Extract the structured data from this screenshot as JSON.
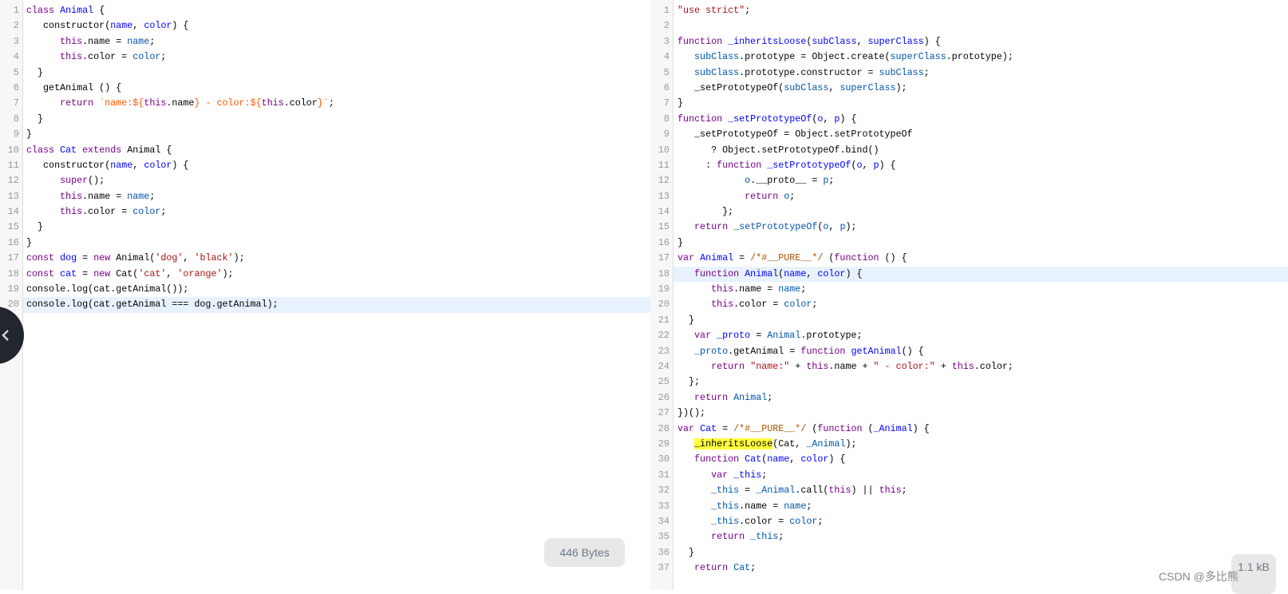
{
  "colors": {
    "keyword": "#770088",
    "def": "#0000ff",
    "variable": "#0055aa",
    "string": "#aa1111",
    "template": "#ff5500",
    "comment": "#aa5500",
    "highlight": "#ffff3c",
    "active_line": "#e8f2ff"
  },
  "left": {
    "active_line": 20,
    "size_label": "446 Bytes",
    "lines": [
      [
        [
          "class",
          "k"
        ],
        [
          " "
        ],
        [
          "Animal",
          "d"
        ],
        [
          " {"
        ]
      ],
      [
        [
          "   constructor("
        ],
        [
          "name",
          "d"
        ],
        [
          ", "
        ],
        [
          "color",
          "d"
        ],
        [
          ") {"
        ]
      ],
      [
        [
          "      "
        ],
        [
          "this",
          "k"
        ],
        [
          ".name = "
        ],
        [
          "name",
          "v"
        ],
        [
          ";"
        ]
      ],
      [
        [
          "      "
        ],
        [
          "this",
          "k"
        ],
        [
          ".color = "
        ],
        [
          "color",
          "v"
        ],
        [
          ";"
        ]
      ],
      [
        [
          "  }"
        ]
      ],
      [
        [
          "   getAnimal () {"
        ]
      ],
      [
        [
          "      "
        ],
        [
          "return",
          "k"
        ],
        [
          " "
        ],
        [
          "`name:${",
          "t"
        ],
        [
          "this",
          "k"
        ],
        [
          ".name"
        ],
        [
          "} - color:${",
          "t"
        ],
        [
          "this",
          "k"
        ],
        [
          ".color"
        ],
        [
          "}`",
          "t"
        ],
        [
          ";"
        ]
      ],
      [
        [
          "  }"
        ]
      ],
      [
        [
          "}"
        ]
      ],
      [
        [
          "class",
          "k"
        ],
        [
          " "
        ],
        [
          "Cat",
          "d"
        ],
        [
          " "
        ],
        [
          "extends",
          "k"
        ],
        [
          " Animal {"
        ]
      ],
      [
        [
          "   constructor("
        ],
        [
          "name",
          "d"
        ],
        [
          ", "
        ],
        [
          "color",
          "d"
        ],
        [
          ") {"
        ]
      ],
      [
        [
          "      "
        ],
        [
          "super",
          "k"
        ],
        [
          "();"
        ]
      ],
      [
        [
          "      "
        ],
        [
          "this",
          "k"
        ],
        [
          ".name = "
        ],
        [
          "name",
          "v"
        ],
        [
          ";"
        ]
      ],
      [
        [
          "      "
        ],
        [
          "this",
          "k"
        ],
        [
          ".color = "
        ],
        [
          "color",
          "v"
        ],
        [
          ";"
        ]
      ],
      [
        [
          "  }"
        ]
      ],
      [
        [
          "}"
        ]
      ],
      [
        [
          "const",
          "k"
        ],
        [
          " "
        ],
        [
          "dog",
          "d"
        ],
        [
          " = "
        ],
        [
          "new",
          "k"
        ],
        [
          " Animal("
        ],
        [
          "'dog'",
          "s"
        ],
        [
          ", "
        ],
        [
          "'black'",
          "s"
        ],
        [
          ");"
        ]
      ],
      [
        [
          "const",
          "k"
        ],
        [
          " "
        ],
        [
          "cat",
          "d"
        ],
        [
          " = "
        ],
        [
          "new",
          "k"
        ],
        [
          " Cat("
        ],
        [
          "'cat'",
          "s"
        ],
        [
          ", "
        ],
        [
          "'orange'",
          "s"
        ],
        [
          ");"
        ]
      ],
      [
        [
          "console.log(cat.getAnimal());"
        ]
      ],
      [
        [
          "console.log(cat.getAnimal === dog.getAnimal);"
        ]
      ]
    ]
  },
  "right": {
    "active_line": 18,
    "size_label": "1.1 kB",
    "lines": [
      [
        [
          "\"use strict\"",
          "s"
        ],
        [
          ";"
        ]
      ],
      [
        [
          ""
        ]
      ],
      [
        [
          "function",
          "k"
        ],
        [
          " "
        ],
        [
          "_inheritsLoose",
          "d"
        ],
        [
          "("
        ],
        [
          "subClass",
          "d"
        ],
        [
          ", "
        ],
        [
          "superClass",
          "d"
        ],
        [
          ") {"
        ]
      ],
      [
        [
          "   "
        ],
        [
          "subClass",
          "v"
        ],
        [
          ".prototype = Object.create("
        ],
        [
          "superClass",
          "v"
        ],
        [
          ".prototype);"
        ]
      ],
      [
        [
          "   "
        ],
        [
          "subClass",
          "v"
        ],
        [
          ".prototype.constructor = "
        ],
        [
          "subClass",
          "v"
        ],
        [
          ";"
        ]
      ],
      [
        [
          "   _setPrototypeOf("
        ],
        [
          "subClass",
          "v"
        ],
        [
          ", "
        ],
        [
          "superClass",
          "v"
        ],
        [
          ");"
        ]
      ],
      [
        [
          "}"
        ]
      ],
      [
        [
          "function",
          "k"
        ],
        [
          " "
        ],
        [
          "_setPrototypeOf",
          "d"
        ],
        [
          "("
        ],
        [
          "o",
          "d"
        ],
        [
          ", "
        ],
        [
          "p",
          "d"
        ],
        [
          ") {"
        ]
      ],
      [
        [
          "   _setPrototypeOf = Object.setPrototypeOf"
        ]
      ],
      [
        [
          "      ? Object.setPrototypeOf.bind()"
        ]
      ],
      [
        [
          "     : "
        ],
        [
          "function",
          "k"
        ],
        [
          " "
        ],
        [
          "_setPrototypeOf",
          "d"
        ],
        [
          "("
        ],
        [
          "o",
          "d"
        ],
        [
          ", "
        ],
        [
          "p",
          "d"
        ],
        [
          ") {"
        ]
      ],
      [
        [
          "            "
        ],
        [
          "o",
          "v"
        ],
        [
          ".__proto__ = "
        ],
        [
          "p",
          "v"
        ],
        [
          ";"
        ]
      ],
      [
        [
          "            "
        ],
        [
          "return",
          "k"
        ],
        [
          " "
        ],
        [
          "o",
          "v"
        ],
        [
          ";"
        ]
      ],
      [
        [
          "        };"
        ]
      ],
      [
        [
          "   "
        ],
        [
          "return",
          "k"
        ],
        [
          " "
        ],
        [
          "_setPrototypeOf",
          "v"
        ],
        [
          "("
        ],
        [
          "o",
          "v"
        ],
        [
          ", "
        ],
        [
          "p",
          "v"
        ],
        [
          ");"
        ]
      ],
      [
        [
          "}"
        ]
      ],
      [
        [
          "var",
          "k"
        ],
        [
          " "
        ],
        [
          "Animal",
          "d"
        ],
        [
          " = "
        ],
        [
          "/*#__PURE__*/",
          "c"
        ],
        [
          " ("
        ],
        [
          "function",
          "k"
        ],
        [
          " () {"
        ]
      ],
      [
        [
          "   "
        ],
        [
          "function",
          "k"
        ],
        [
          " "
        ],
        [
          "Animal",
          "d"
        ],
        [
          "("
        ],
        [
          "name",
          "d"
        ],
        [
          ", "
        ],
        [
          "color",
          "d"
        ],
        [
          ") {"
        ]
      ],
      [
        [
          "      "
        ],
        [
          "this",
          "k"
        ],
        [
          ".name = "
        ],
        [
          "name",
          "v"
        ],
        [
          ";"
        ]
      ],
      [
        [
          "      "
        ],
        [
          "this",
          "k"
        ],
        [
          ".color = "
        ],
        [
          "color",
          "v"
        ],
        [
          ";"
        ]
      ],
      [
        [
          "  }"
        ]
      ],
      [
        [
          "   "
        ],
        [
          "var",
          "k"
        ],
        [
          " "
        ],
        [
          "_proto",
          "d"
        ],
        [
          " = "
        ],
        [
          "Animal",
          "v"
        ],
        [
          ".prototype;"
        ]
      ],
      [
        [
          "   "
        ],
        [
          "_proto",
          "v"
        ],
        [
          ".getAnimal = "
        ],
        [
          "function",
          "k"
        ],
        [
          " "
        ],
        [
          "getAnimal",
          "d"
        ],
        [
          "() {"
        ]
      ],
      [
        [
          "      "
        ],
        [
          "return",
          "k"
        ],
        [
          " "
        ],
        [
          "\"name:\"",
          "s"
        ],
        [
          " + "
        ],
        [
          "this",
          "k"
        ],
        [
          ".name + "
        ],
        [
          "\" - color:\"",
          "s"
        ],
        [
          " + "
        ],
        [
          "this",
          "k"
        ],
        [
          ".color;"
        ]
      ],
      [
        [
          "  };"
        ]
      ],
      [
        [
          "   "
        ],
        [
          "return",
          "k"
        ],
        [
          " "
        ],
        [
          "Animal",
          "v"
        ],
        [
          ";"
        ]
      ],
      [
        [
          "})();"
        ]
      ],
      [
        [
          "var",
          "k"
        ],
        [
          " "
        ],
        [
          "Cat",
          "d"
        ],
        [
          " = "
        ],
        [
          "/*#__PURE__*/",
          "c"
        ],
        [
          " ("
        ],
        [
          "function",
          "k"
        ],
        [
          " ("
        ],
        [
          "_Animal",
          "d"
        ],
        [
          ") {"
        ]
      ],
      [
        [
          "   "
        ],
        [
          "_inheritsLoose",
          "h"
        ],
        [
          "(Cat, "
        ],
        [
          "_Animal",
          "v"
        ],
        [
          ");"
        ]
      ],
      [
        [
          "   "
        ],
        [
          "function",
          "k"
        ],
        [
          " "
        ],
        [
          "Cat",
          "d"
        ],
        [
          "("
        ],
        [
          "name",
          "d"
        ],
        [
          ", "
        ],
        [
          "color",
          "d"
        ],
        [
          ") {"
        ]
      ],
      [
        [
          "      "
        ],
        [
          "var",
          "k"
        ],
        [
          " "
        ],
        [
          "_this",
          "d"
        ],
        [
          ";"
        ]
      ],
      [
        [
          "      "
        ],
        [
          "_this",
          "v"
        ],
        [
          " = "
        ],
        [
          "_Animal",
          "v"
        ],
        [
          ".call("
        ],
        [
          "this",
          "k"
        ],
        [
          ") || "
        ],
        [
          "this",
          "k"
        ],
        [
          ";"
        ]
      ],
      [
        [
          "      "
        ],
        [
          "_this",
          "v"
        ],
        [
          ".name = "
        ],
        [
          "name",
          "v"
        ],
        [
          ";"
        ]
      ],
      [
        [
          "      "
        ],
        [
          "_this",
          "v"
        ],
        [
          ".color = "
        ],
        [
          "color",
          "v"
        ],
        [
          ";"
        ]
      ],
      [
        [
          "      "
        ],
        [
          "return",
          "k"
        ],
        [
          " "
        ],
        [
          "_this",
          "v"
        ],
        [
          ";"
        ]
      ],
      [
        [
          "  }"
        ]
      ],
      [
        [
          "   "
        ],
        [
          "return",
          "k"
        ],
        [
          " "
        ],
        [
          "Cat",
          "v"
        ],
        [
          ";"
        ]
      ]
    ]
  },
  "collapse_button": {
    "icon": "chevron-left-icon"
  },
  "watermark": "CSDN @多比熊"
}
